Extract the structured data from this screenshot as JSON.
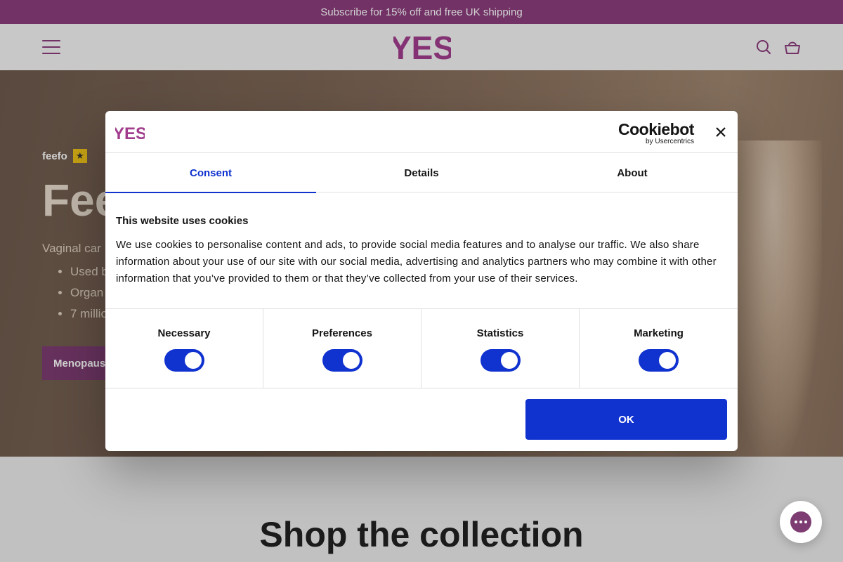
{
  "announcement": {
    "text": "Subscribe for 15% off and free UK shipping"
  },
  "header": {
    "logo_text": "YES",
    "menu_icon": "hamburger-menu-icon",
    "search_icon": "search-icon",
    "cart_icon": "basket-icon"
  },
  "hero": {
    "feefo_label": "feefo",
    "title": "Fee",
    "subtitle": "Vaginal car",
    "bullets": [
      "Used b",
      "Organ",
      "7 millio"
    ],
    "button_label": "Menopaus"
  },
  "shop": {
    "title": "Shop the collection"
  },
  "cookie_dialog": {
    "logo_text": "YES",
    "brand_name": "Cookiebot",
    "brand_by": "by Usercentrics",
    "close_icon": "close-icon",
    "tabs": [
      {
        "label": "Consent",
        "active": true
      },
      {
        "label": "Details",
        "active": false
      },
      {
        "label": "About",
        "active": false
      }
    ],
    "heading": "This website uses cookies",
    "body": "We use cookies to personalise content and ads, to provide social media features and to analyse our traffic. We also share information about your use of our site with our social media, advertising and analytics partners who may combine it with other information that you’ve provided to them or that they’ve collected from your use of their services.",
    "toggles": [
      {
        "label": "Necessary",
        "checked": true
      },
      {
        "label": "Preferences",
        "checked": true
      },
      {
        "label": "Statistics",
        "checked": true
      },
      {
        "label": "Marketing",
        "checked": true
      }
    ],
    "ok_label": "OK"
  },
  "chat": {
    "icon": "chat-bubble-icon"
  },
  "colors": {
    "brand_purple": "#8b3e7d",
    "cookiebot_blue": "#1032cf"
  }
}
